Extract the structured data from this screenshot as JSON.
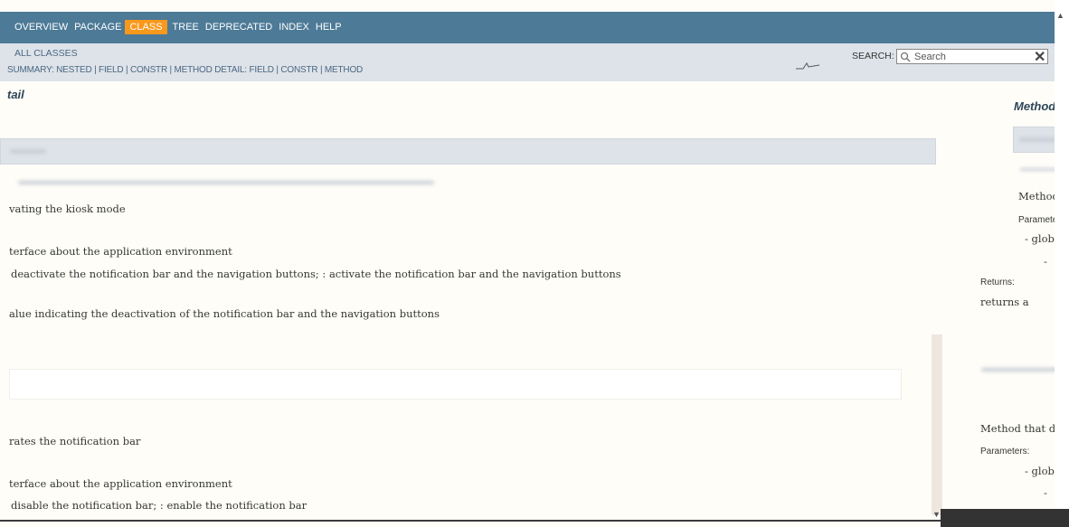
{
  "nav": {
    "items": [
      {
        "label": "OVERVIEW",
        "active": false
      },
      {
        "label": "PACKAGE",
        "active": false
      },
      {
        "label": "CLASS",
        "active": true
      },
      {
        "label": "TREE",
        "active": false
      },
      {
        "label": "DEPRECATED",
        "active": false
      },
      {
        "label": "INDEX",
        "active": false
      },
      {
        "label": "HELP",
        "active": false
      }
    ]
  },
  "subnav": {
    "all_classes": "ALL CLASSES",
    "summary_line": "SUMMARY: NESTED | FIELD | CONSTR | METHOD   DETAIL: FIELD | CONSTR | METHOD"
  },
  "search": {
    "label": "SEARCH:",
    "placeholder": "Search"
  },
  "main": {
    "heading": "tail",
    "method1": {
      "description": "vating the kiosk mode",
      "param_desc": "terface about the application environment",
      "param_values": "deactivate the notification bar and the navigation buttons;        : activate the notification bar and the navigation buttons",
      "returns_desc": "alue indicating the deactivation of the notification bar and the navigation buttons"
    },
    "method2": {
      "description": "rates the notification bar",
      "param_desc": "terface about the application environment",
      "param_values": "disable the notification bar;        : enable the notification bar"
    }
  },
  "right": {
    "heading": "Method D",
    "text1": "Method ac",
    "params_label": "Parameters",
    "param1": "- global i",
    "dash": "-",
    "returns_label": "Returns:",
    "returns_text": "returns a",
    "text2": "Method that deact",
    "params_label2": "Parameters:",
    "param2": "- global i",
    "dash2": "-"
  },
  "colors": {
    "nav_bg": "#4d7a97",
    "active_bg": "#f8981d",
    "subnav_bg": "#dee3e9"
  }
}
